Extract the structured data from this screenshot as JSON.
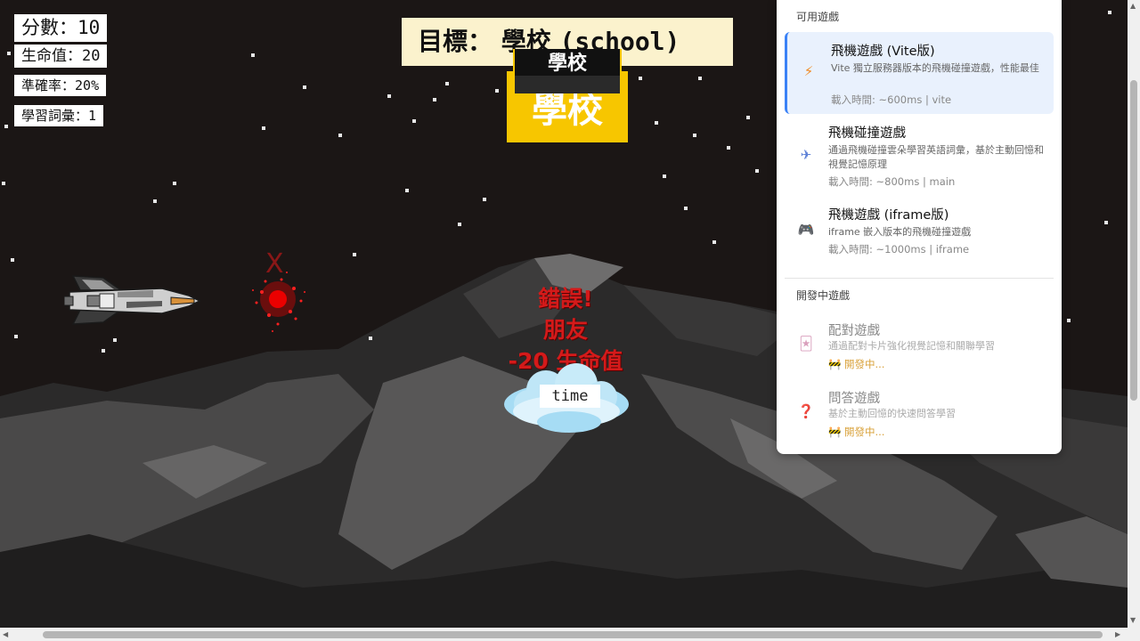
{
  "hud": {
    "score_label": "分數：",
    "score_value": "10",
    "life_label": "生命值：",
    "life_value": "20",
    "accuracy_label": "準確率：",
    "accuracy_value": "20%",
    "vocab_label": "學習詞彙：",
    "vocab_value": "1"
  },
  "target": {
    "label": "目標：",
    "chinese": "學校",
    "english": "(school)"
  },
  "cards": {
    "big": "學校",
    "small": "學校"
  },
  "burst_mark": "X",
  "feedback": {
    "line1": "錯誤!",
    "line2": "朋友",
    "line3": "-20 生命值"
  },
  "cloud_word": "time",
  "colors": {
    "background": "#1b1615",
    "card": "#f7c600",
    "error": "#d41a1a",
    "accent": "#3b82f6"
  },
  "panel": {
    "available_title": "可用遊戲",
    "available": [
      {
        "icon": "lightning-icon",
        "title": "飛機遊戲 (Vite版)",
        "desc": "Vite 獨立服務器版本的飛機碰撞遊戲，性能最佳",
        "meta": "載入時間: ~600ms | vite",
        "active": true
      },
      {
        "icon": "airplane-icon",
        "title": "飛機碰撞遊戲",
        "desc": "通過飛機碰撞雲朵學習英語詞彙，基於主動回憶和視覺記憶原理",
        "meta": "載入時間: ~800ms | main",
        "active": false
      },
      {
        "icon": "gamepad-icon",
        "title": "飛機遊戲 (iframe版)",
        "desc": "iframe 嵌入版本的飛機碰撞遊戲",
        "meta": "載入時間: ~1000ms | iframe",
        "active": false
      }
    ],
    "dev_title": "開發中遊戲",
    "dev": [
      {
        "icon": "card-icon",
        "title": "配對遊戲",
        "desc": "通過配對卡片強化視覺記憶和關聯學習",
        "meta": "🚧 開發中..."
      },
      {
        "icon": "question-icon",
        "title": "問答遊戲",
        "desc": "基於主動回憶的快速問答學習",
        "meta": "🚧 開發中..."
      }
    ]
  }
}
